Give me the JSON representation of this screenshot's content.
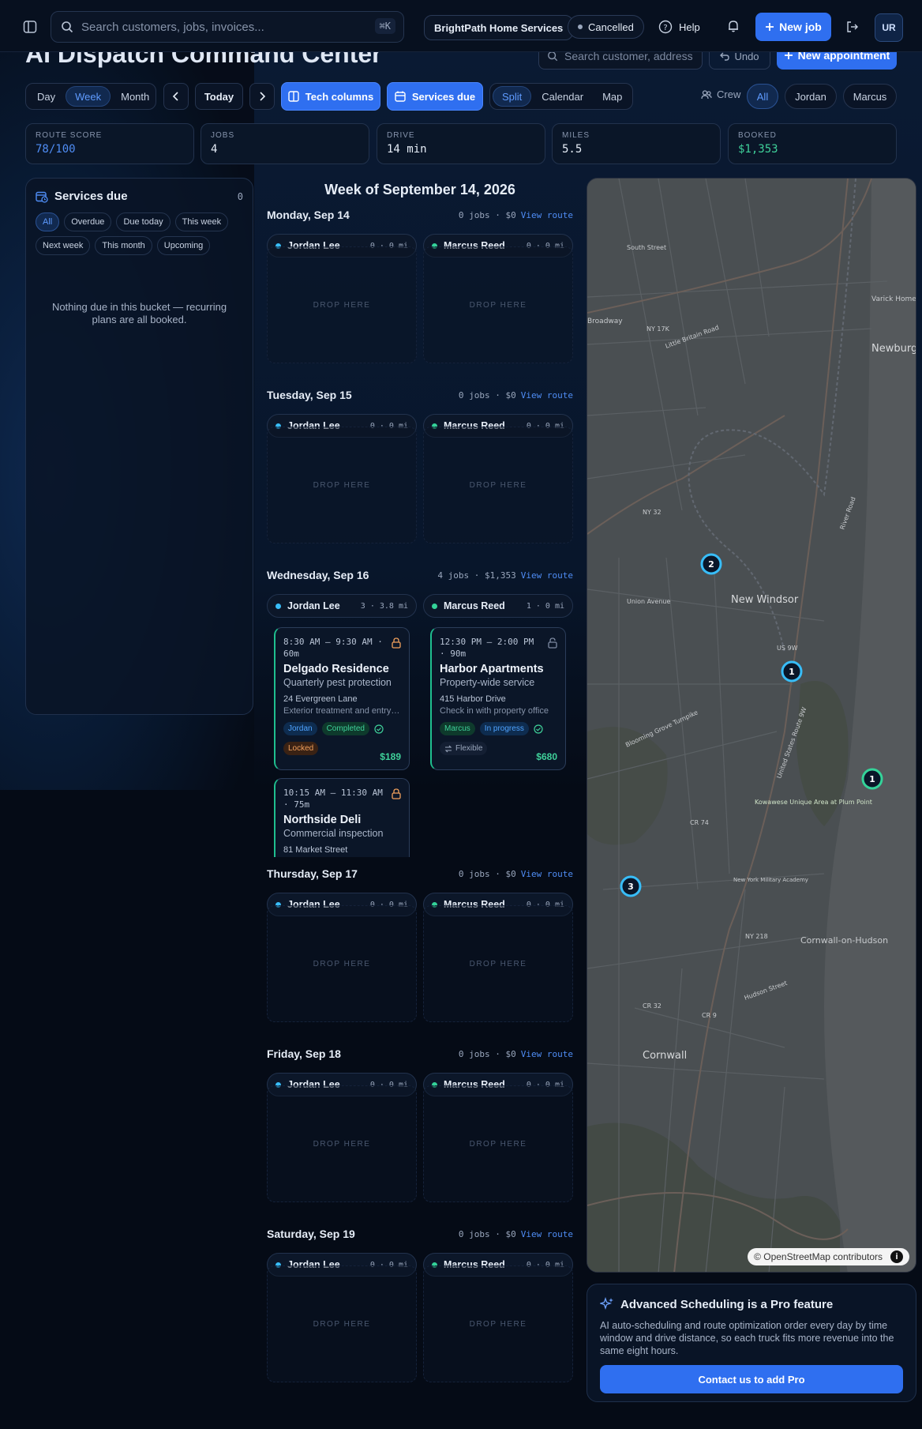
{
  "topbar": {
    "search_placeholder": "Search customers, jobs, invoices...",
    "shortcut": "⌘K",
    "company": "BrightPath Home Services",
    "status": "Cancelled",
    "help": "Help",
    "new_job": "New job",
    "avatar": "UR"
  },
  "page": {
    "title": "AI Dispatch Command Center",
    "search_placeholder": "Search customer, address",
    "undo": "Undo",
    "new_appointment": "New appointment"
  },
  "toolbar": {
    "views": [
      "Day",
      "Week",
      "Month"
    ],
    "active_view": "Week",
    "today": "Today",
    "tech_columns": "Tech columns",
    "services_due": "Services due",
    "layouts": [
      "Split",
      "Calendar",
      "Map"
    ],
    "active_layout": "Split",
    "crew_label": "Crew",
    "crew": [
      "All",
      "Jordan",
      "Marcus"
    ],
    "active_crew": "All"
  },
  "stats": [
    {
      "label": "ROUTE SCORE",
      "value": "78/100",
      "color": "#4f8df5"
    },
    {
      "label": "JOBS",
      "value": "4",
      "color": "#e6edf7"
    },
    {
      "label": "DRIVE",
      "value": "14 min",
      "color": "#e6edf7"
    },
    {
      "label": "MILES",
      "value": "5.5",
      "color": "#e6edf7"
    },
    {
      "label": "BOOKED",
      "value": "$1,353",
      "color": "#3fd19a"
    }
  ],
  "services_due": {
    "title": "Services due",
    "count": "0",
    "filters": [
      "All",
      "Overdue",
      "Due today",
      "This week",
      "Next week",
      "This month",
      "Upcoming"
    ],
    "active_filter": "All",
    "empty": "Nothing due in this bucket — recurring plans are all booked."
  },
  "calendar": {
    "week_title": "Week of September 14, 2026",
    "drop_label": "DROP HERE",
    "view_route": "View route",
    "days": [
      {
        "name": "Monday, Sep 14",
        "summary": "0 jobs · $0",
        "jordan": "0 · 0 mi",
        "marcus": "0 · 0 mi"
      },
      {
        "name": "Tuesday, Sep 15",
        "summary": "0 jobs · $0",
        "jordan": "0 · 0 mi",
        "marcus": "0 · 0 mi"
      },
      {
        "name": "Wednesday, Sep 16",
        "summary": "4 jobs · $1,353",
        "jordan": "3 · 3.8 mi",
        "marcus": "1 · 0 mi"
      },
      {
        "name": "Thursday, Sep 17",
        "summary": "0 jobs · $0",
        "jordan": "0 · 0 mi",
        "marcus": "0 · 0 mi"
      },
      {
        "name": "Friday, Sep 18",
        "summary": "0 jobs · $0",
        "jordan": "0 · 0 mi",
        "marcus": "0 · 0 mi"
      },
      {
        "name": "Saturday, Sep 19",
        "summary": "0 jobs · $0",
        "jordan": "0 · 0 mi",
        "marcus": "0 · 0 mi"
      }
    ],
    "techs": [
      {
        "name": "Jordan Lee",
        "color": "#38bdf8"
      },
      {
        "name": "Marcus Reed",
        "color": "#34d399"
      }
    ],
    "jobs": [
      {
        "time": "8:30 AM – 9:30 AM · 60m",
        "title": "Delgado Residence",
        "service": "Quarterly pest protection",
        "address": "24 Evergreen Lane",
        "note": "Exterior treatment and entry points",
        "tech": "Jordan",
        "status": "Completed",
        "flag": "Locked",
        "price": "$189"
      },
      {
        "time": "12:30 PM – 2:00 PM · 90m",
        "title": "Harbor Apartments",
        "service": "Property-wide service",
        "address": "415 Harbor Drive",
        "note": "Check in with property office",
        "tech": "Marcus",
        "status": "In progress",
        "flag": "Flexible",
        "price": "$680"
      },
      {
        "time": "10:15 AM – 11:30 AM · 75m",
        "title": "Northside Deli",
        "service": "Commercial inspection",
        "address": "81 Market Street"
      }
    ]
  },
  "map": {
    "labels": [
      "Newburgh",
      "New Windsor",
      "Cornwall",
      "Cornwall-on-Hudson",
      "Varick Homes",
      "NY 17K",
      "NY 32",
      "US 9W",
      "NY 218",
      "CR 74",
      "CR 32",
      "CR 9",
      "Broadway",
      "South Street",
      "Union Avenue",
      "Little Britain Road",
      "Blooming Grove Turnpike",
      "River Road",
      "Kowawese Unique Area at Plum Point",
      "New York Military Academy",
      "United States Route 9W",
      "Hudson Street"
    ],
    "markers": [
      "2",
      "1",
      "1",
      "3"
    ],
    "attribution": "© OpenStreetMap contributors"
  },
  "pro": {
    "title": "Advanced Scheduling is a Pro feature",
    "description": "AI auto-scheduling and route optimization order every day by time window and drive distance, so each truck fits more revenue into the same eight hours.",
    "cta": "Contact us to add Pro"
  }
}
